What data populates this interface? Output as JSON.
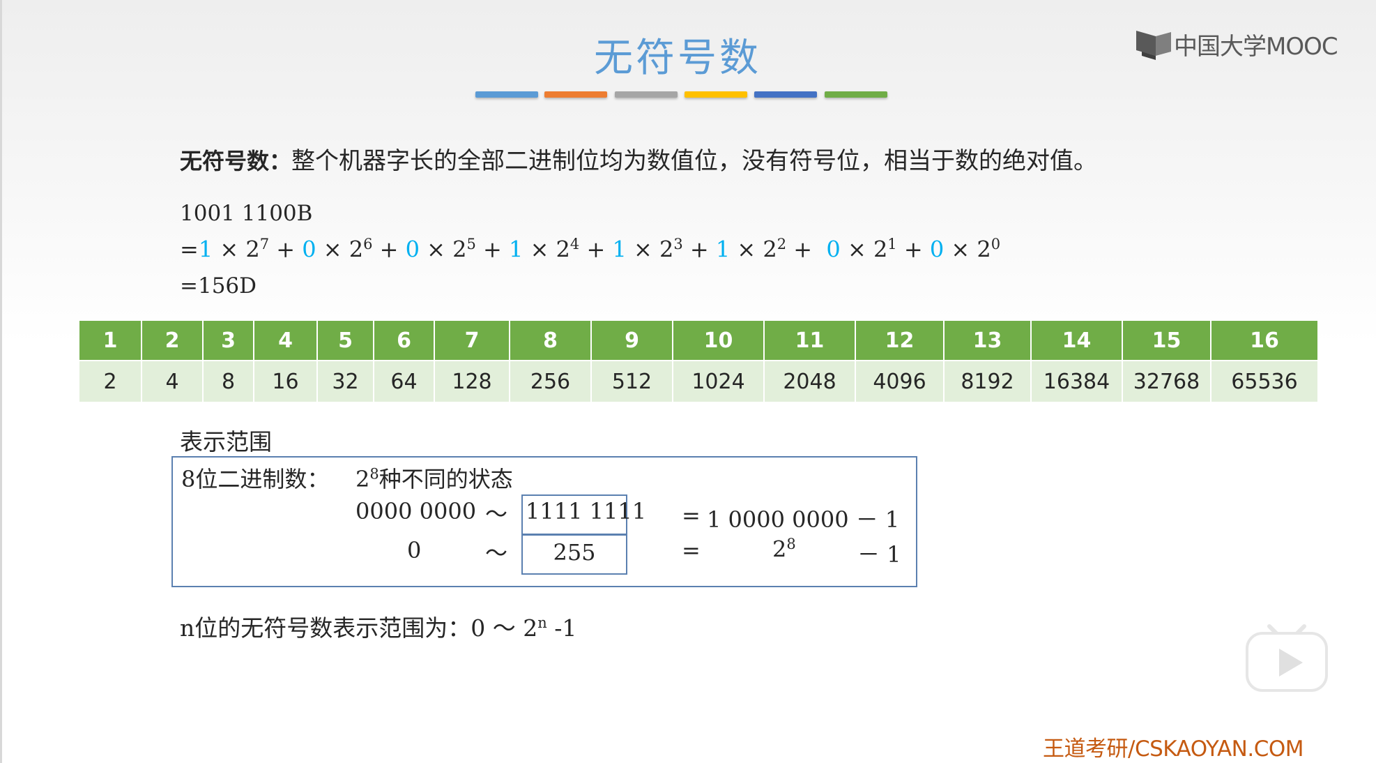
{
  "title": "无符号数",
  "title_bar_colors": [
    "#5b9bd5",
    "#ed7d31",
    "#a5a5a5",
    "#ffc000",
    "#4472c4",
    "#70ad47"
  ],
  "logo": {
    "icon": "mooc-logo-icon",
    "text": "中国大学MOOC"
  },
  "definition": {
    "term": "无符号数：",
    "text": "整个机器字长的全部二进制位均为数值位，没有符号位，相当于数的绝对值。"
  },
  "example": {
    "binary": "1001 1100B",
    "prefix": "=",
    "terms": [
      {
        "coef": "1",
        "base": "2",
        "exp": "7"
      },
      {
        "coef": "0",
        "base": "2",
        "exp": "6"
      },
      {
        "coef": "0",
        "base": "2",
        "exp": "5"
      },
      {
        "coef": "1",
        "base": "2",
        "exp": "4"
      },
      {
        "coef": "1",
        "base": "2",
        "exp": "3"
      },
      {
        "coef": "1",
        "base": "2",
        "exp": "2"
      },
      {
        "coef": "0",
        "base": "2",
        "exp": "1"
      },
      {
        "coef": "0",
        "base": "2",
        "exp": "0"
      }
    ],
    "result": "=156D"
  },
  "power_table": {
    "header_color": "#70ad47",
    "row_color": "#e2efda",
    "headers": [
      "1",
      "2",
      "3",
      "4",
      "5",
      "6",
      "7",
      "8",
      "9",
      "10",
      "11",
      "12",
      "13",
      "14",
      "15",
      "16"
    ],
    "values": [
      "2",
      "4",
      "8",
      "16",
      "32",
      "64",
      "128",
      "256",
      "512",
      "1024",
      "2048",
      "4096",
      "8192",
      "16384",
      "32768",
      "65536"
    ]
  },
  "range": {
    "heading": "表示范围",
    "box_label": "8位二进制数：",
    "states_base": "2",
    "states_exp": "8",
    "states_text": "种不同的状态",
    "row1": {
      "left": "0000  0000",
      "tilde": "～",
      "boxed": "1111  1111",
      "eq": "=",
      "right": "1  0000  0000  －  1"
    },
    "row2": {
      "left": "0",
      "tilde": "～",
      "boxed": "255",
      "eq": "=",
      "right_base": "2",
      "right_exp": "8",
      "right_tail": "－  1"
    }
  },
  "summary": {
    "text": "n位的无符号数表示范围为：0  ～  ",
    "base": "2",
    "exp": "n",
    "tail": " -1"
  },
  "play_button": {
    "icon": "play-icon"
  },
  "footer": "王道考研/CSKAOYAN.COM"
}
